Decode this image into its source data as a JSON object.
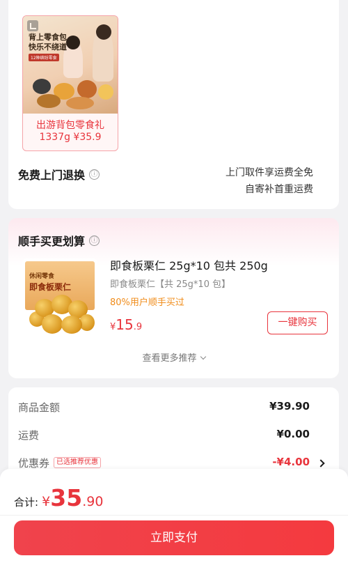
{
  "gift": {
    "image_line1": "背上零食包",
    "image_line2": "快乐不绕道",
    "image_tag": "12种缤纷零食",
    "caption1": "出游背包零食礼",
    "caption2": "1337g ¥35.9"
  },
  "return_service": {
    "title": "免费上门退换",
    "info_icon": "ⓘ",
    "desc_line1": "上门取件享运费全免",
    "desc_line2": "自寄补首重运费"
  },
  "recommend": {
    "title": "顺手买更划算",
    "info_icon": "ⓘ",
    "product": {
      "box_label": "即食板栗仁",
      "box_label_small": "休闲零食",
      "name": "即食板栗仁 25g*10 包共 250g",
      "spec": "即食板栗仁【共 25g*10 包】",
      "stat": "80%用户顺手买过",
      "price_currency": "¥",
      "price_int": "15",
      "price_dec": ".9",
      "buy_label": "一键购买"
    },
    "more_label": "查看更多推荐"
  },
  "summary": {
    "rows": [
      {
        "label": "商品金额",
        "value": "¥39.90"
      },
      {
        "label": "运费",
        "value": "¥0.00"
      },
      {
        "label": "优惠券",
        "tag": "已选推荐优惠",
        "value": "-¥4.00"
      }
    ]
  },
  "footer": {
    "total_label": "合计:",
    "total_currency": "¥",
    "total_int": "35",
    "total_dec": ".90",
    "pay_label": "立即支付"
  },
  "colors": {
    "accent": "#e8343c",
    "stat": "#f08c1a"
  }
}
